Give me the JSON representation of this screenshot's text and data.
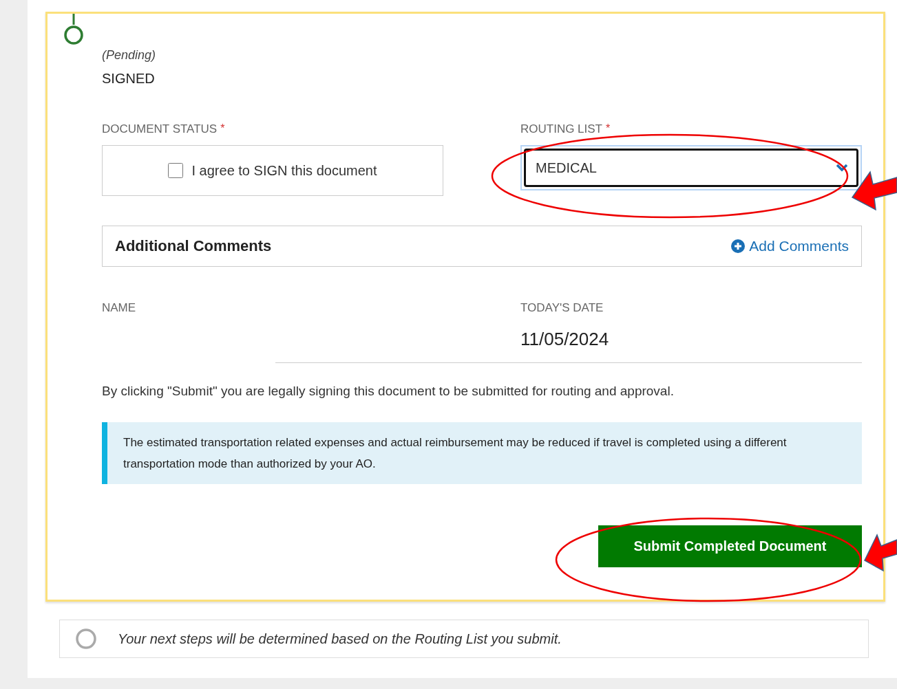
{
  "step": {
    "status": "(Pending)",
    "title": "SIGNED",
    "complete": true
  },
  "document_status": {
    "label": "DOCUMENT STATUS",
    "required_mark": "*",
    "checkbox_label": "I agree to SIGN this document",
    "checked": false
  },
  "routing_list": {
    "label": "ROUTING LIST",
    "required_mark": "*",
    "value": "MEDICAL"
  },
  "additional_comments": {
    "title": "Additional Comments",
    "action": "Add Comments"
  },
  "name": {
    "label": "NAME"
  },
  "todays_date": {
    "label": "TODAY'S DATE",
    "value": "11/05/2024"
  },
  "legal_notice": "By clicking \"Submit\" you are legally signing this document to be submitted for routing and approval.",
  "info_alert": "The estimated transportation related expenses and actual reimbursement may be reduced if travel is completed using a different transportation mode than authorized by your AO.",
  "submit_button": "Submit Completed Document",
  "next_step": {
    "text": "Your next steps will be determined based on the Routing List you submit.",
    "complete": false
  }
}
